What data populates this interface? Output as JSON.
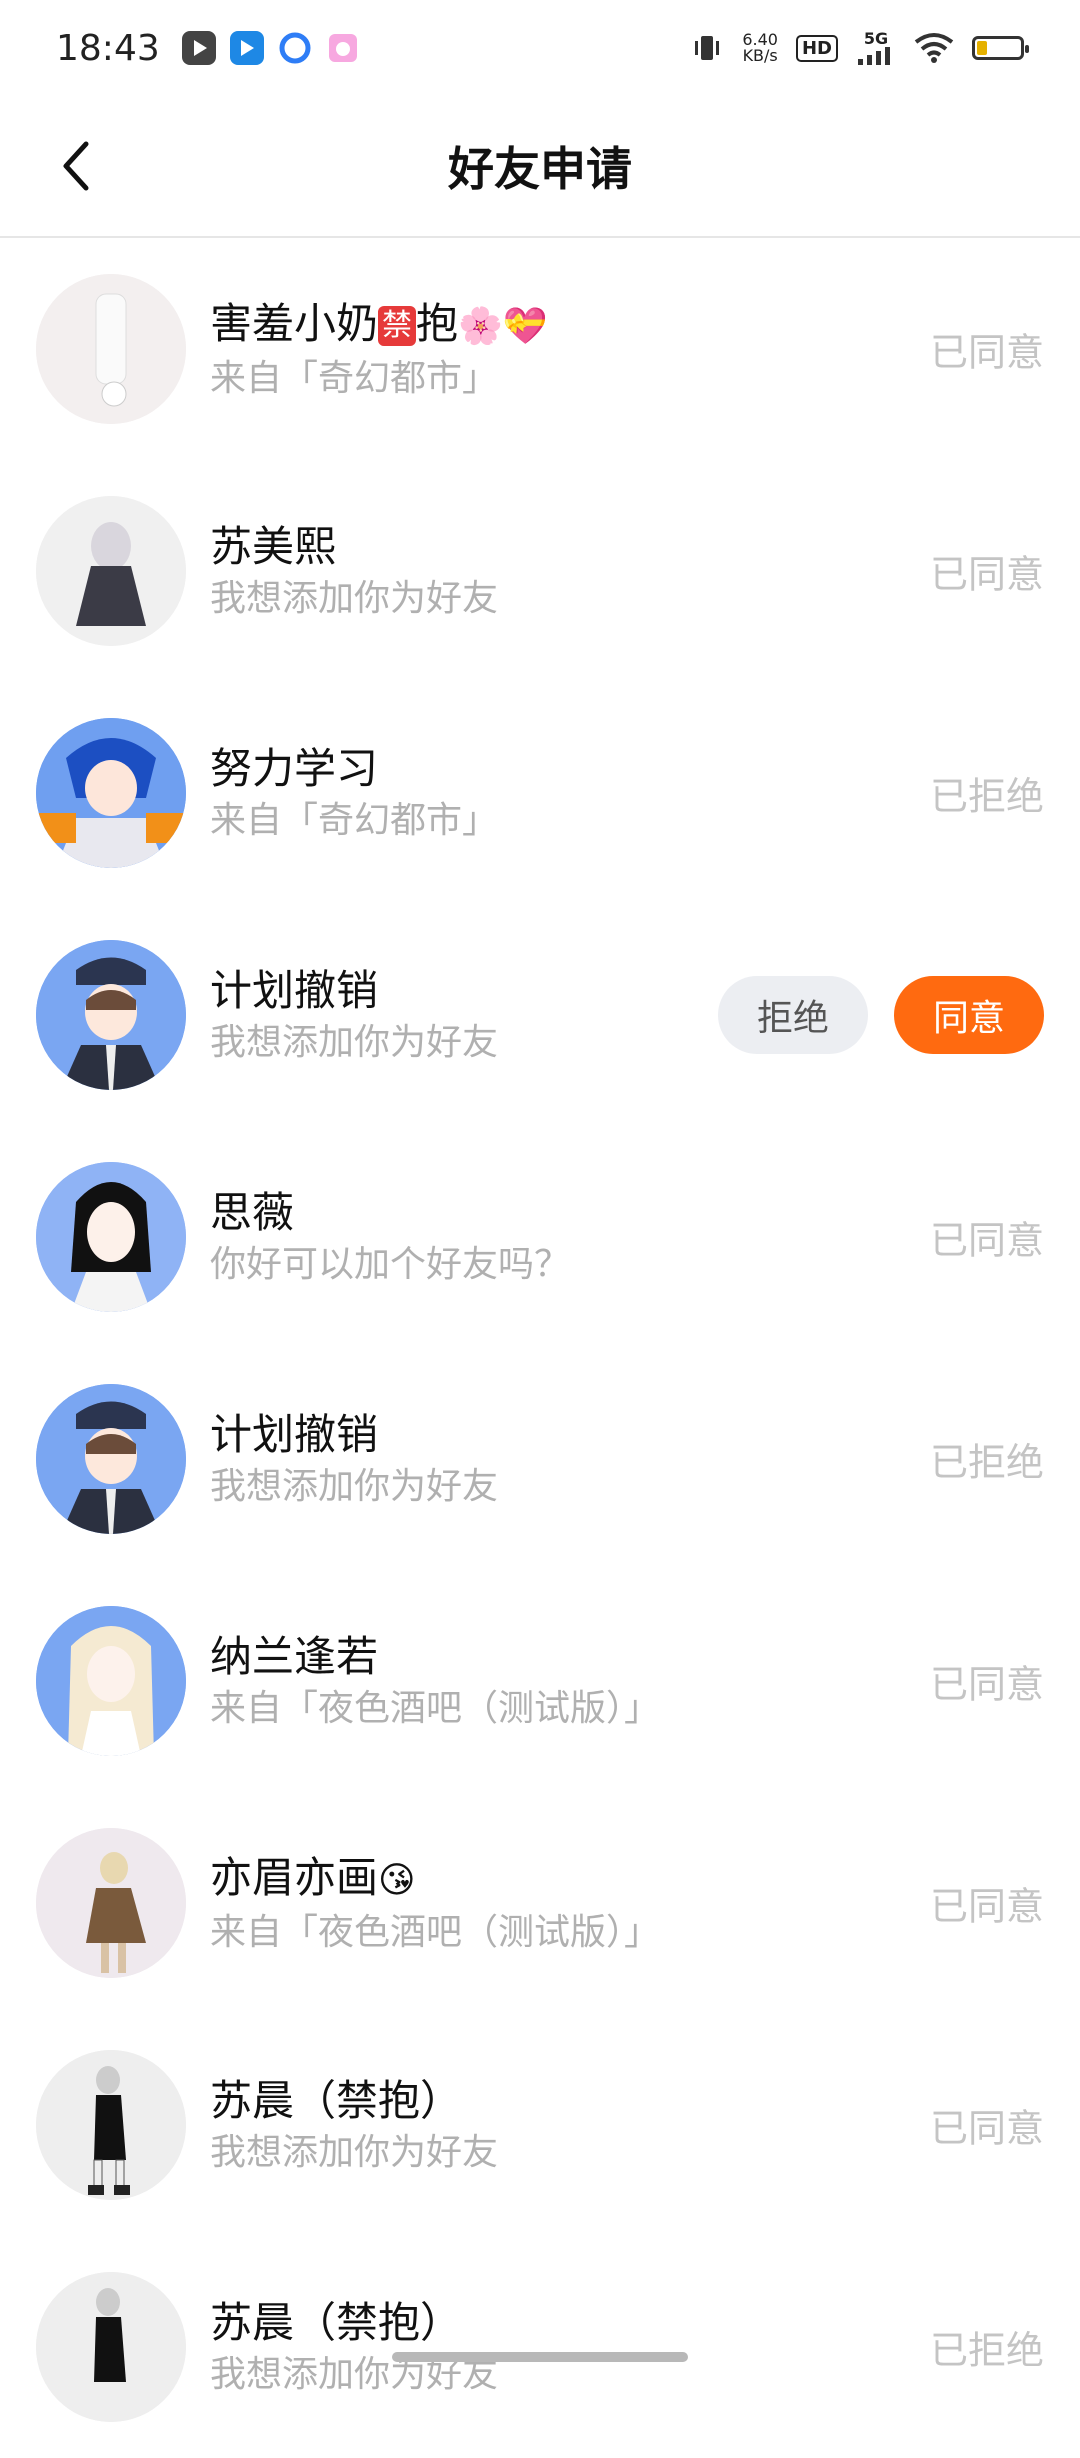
{
  "status_bar": {
    "time": "18:43",
    "net_speed_value": "6.40",
    "net_speed_unit": "KB/s",
    "hd": "HD",
    "network": "5G",
    "app_icons": [
      "video-app-icon",
      "bilibili-icon",
      "browser-icon",
      "camera-app-icon"
    ],
    "battery_level": 0.22
  },
  "header": {
    "title": "好友申请"
  },
  "requests": [
    {
      "name": "害羞小奶",
      "name_badge": "禁",
      "name_after": "抱",
      "name_emoji": "🌸💝",
      "message": "来自「奇幻都市」",
      "status": "已同意",
      "avatar_color": "#f2eeee"
    },
    {
      "name": "苏美熙",
      "message": "我想添加你为好友",
      "status": "已同意",
      "avatar_color": "#f1f1f1"
    },
    {
      "name": "努力学习",
      "message": "来自「奇幻都市」",
      "status": "已拒绝",
      "avatar_color": "#6f9ff0"
    },
    {
      "name": "计划撤销",
      "message": "我想添加你为好友",
      "reject_label": "拒绝",
      "accept_label": "同意",
      "avatar_color": "#7aa6f2"
    },
    {
      "name": "思薇",
      "message": "你好可以加个好友吗？",
      "status": "已同意",
      "avatar_color": "#8fb3f5"
    },
    {
      "name": "计划撤销",
      "message": "我想添加你为好友",
      "status": "已拒绝",
      "avatar_color": "#7aa6f2"
    },
    {
      "name": "纳兰逢若",
      "message": "来自「夜色酒吧（测试版）」",
      "status": "已同意",
      "avatar_color": "#7aa6f2"
    },
    {
      "name": "亦眉亦画",
      "name_emoji": "😘",
      "message": "来自「夜色酒吧（测试版）」",
      "status": "已同意",
      "avatar_color": "#efe9ee"
    },
    {
      "name": "苏晨（禁抱）",
      "message": "我想添加你为好友",
      "status": "已同意",
      "avatar_color": "#eeeeee"
    },
    {
      "name": "苏晨（禁抱）",
      "message": "我想添加你为好友",
      "status": "已拒绝",
      "avatar_color": "#eeeeee"
    }
  ]
}
